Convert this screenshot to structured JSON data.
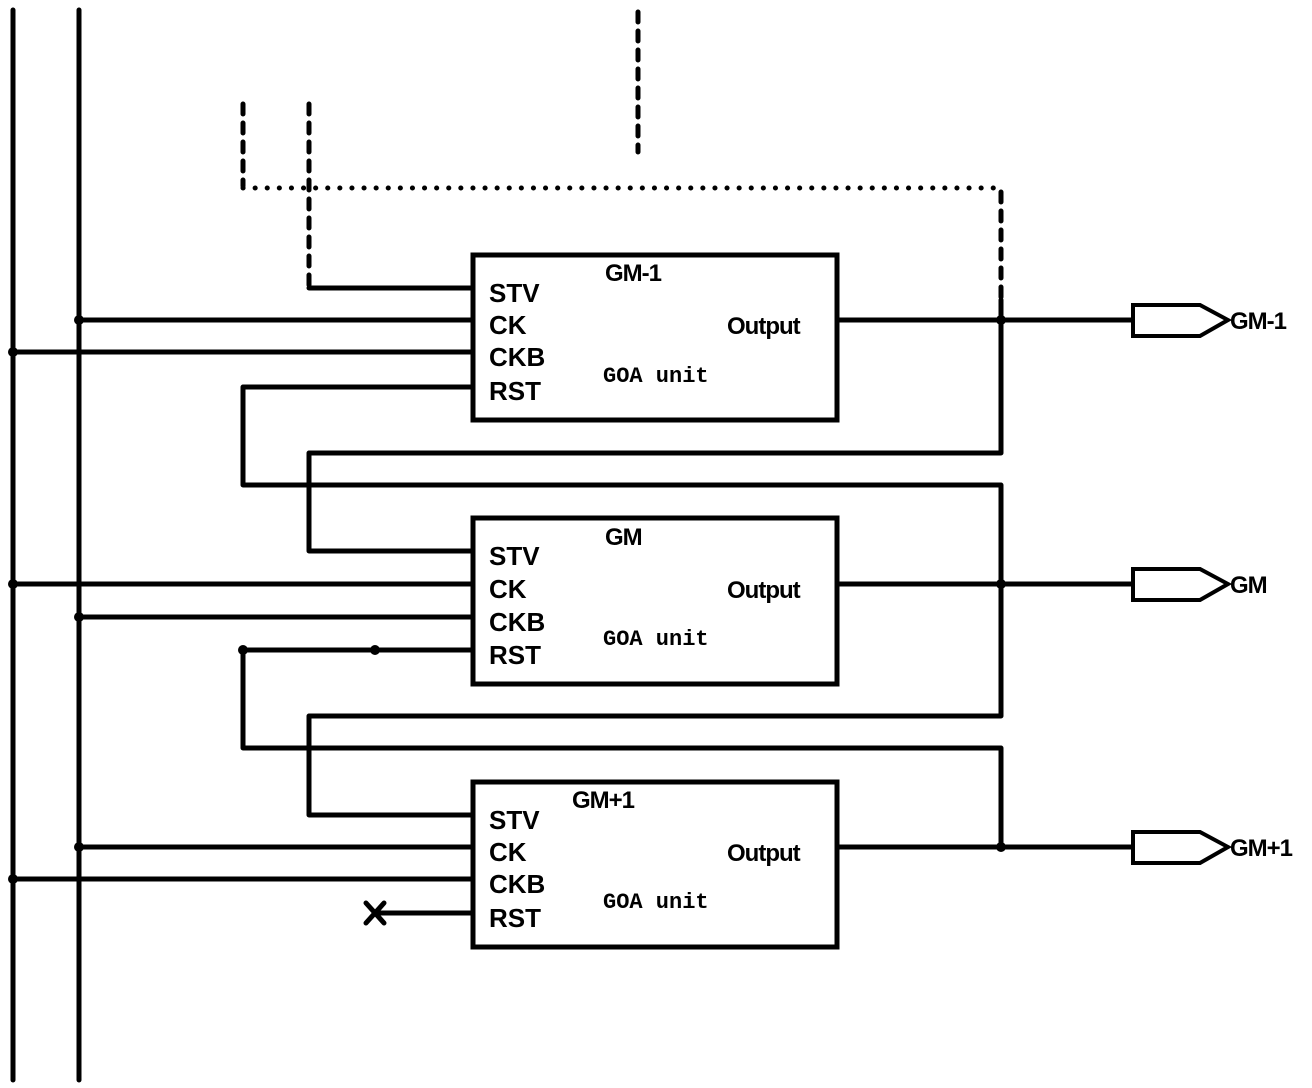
{
  "diagram": {
    "type": "GOA shift register circuit",
    "units": [
      {
        "id": "GM-1",
        "title": "GM-1",
        "subtitle": "GOA unit",
        "pins": [
          "STV",
          "CK",
          "CKB",
          "RST"
        ],
        "output_label": "Output",
        "output_signal": "GM-1"
      },
      {
        "id": "GM",
        "title": "GM",
        "subtitle": "GOA unit",
        "pins": [
          "STV",
          "CK",
          "CKB",
          "RST"
        ],
        "output_label": "Output",
        "output_signal": "GM"
      },
      {
        "id": "GM+1",
        "title": "GM+1",
        "subtitle": "GOA unit",
        "pins": [
          "STV",
          "CK",
          "CKB",
          "RST"
        ],
        "output_label": "Output",
        "output_signal": "GM+1"
      }
    ],
    "rst_unconnected_marker": "X",
    "colors": {
      "stroke": "#000000",
      "background": "#ffffff"
    }
  }
}
